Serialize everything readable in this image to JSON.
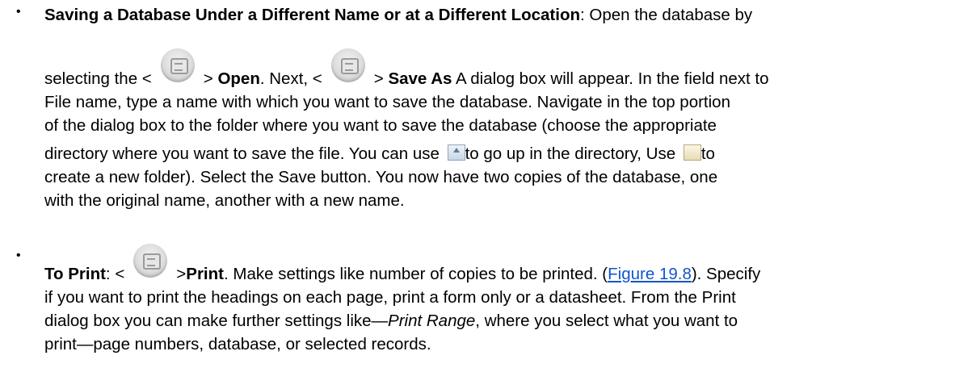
{
  "items": [
    {
      "heading": "Saving a Database Under a Different Name or at a Different Location",
      "intro": ": Open the database by",
      "l2a": "selecting the <",
      "l2b": "> ",
      "open": "Open",
      "l2c": ". Next, <",
      "l2d": "> ",
      "save_as": "Save As",
      "l2e": " A dialog box will appear. In the field next to",
      "l3": "File name, type a name with which you want to save the database. Navigate in the top portion",
      "l4": "of the dialog box to the folder where you want to save the database (choose the appropriate",
      "l5a": "directory where you want to save the file. You can use ",
      "l5b": "to go up in the directory, Use ",
      "l5c": "to",
      "l6": "create a new folder). Select the Save button. You now have two copies of the database, one",
      "l7": "with the original name, another with a new name."
    },
    {
      "heading": "To Print",
      "l1a": ": <",
      "l1b": ">",
      "print": "Print",
      "l1c": ". Make settings like number of copies to be printed. (",
      "link": "Figure 19.8",
      "l1d": "). Specify",
      "l2": "if you want to print the headings on each page, print a form only or a datasheet. From the Print",
      "l3a": "dialog box you can make further settings like—",
      "print_range": "Print Range",
      "l3b": ", where you select what you want to",
      "l4": "print—page numbers, database, or selected records."
    }
  ],
  "bullet_char": "•",
  "icons": [
    "office-button-icon",
    "up-one-level-icon",
    "new-folder-icon"
  ]
}
